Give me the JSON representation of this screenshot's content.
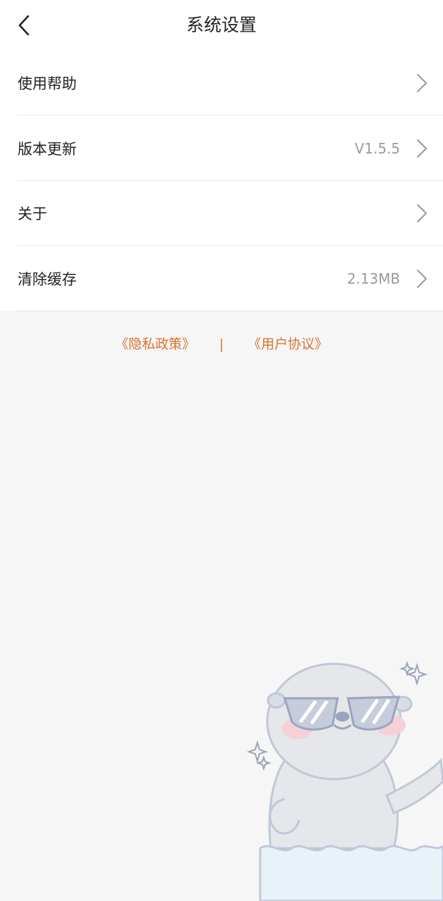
{
  "header": {
    "title": "系统设置"
  },
  "settings": {
    "items": [
      {
        "label": "使用帮助",
        "value": ""
      },
      {
        "label": "版本更新",
        "value": "V1.5.5"
      },
      {
        "label": "关于",
        "value": ""
      },
      {
        "label": "清除缓存",
        "value": "2.13MB"
      }
    ]
  },
  "footer": {
    "privacy": "《隐私政策》",
    "separator": "|",
    "agreement": "《用户协议》"
  },
  "colors": {
    "link": "#d9732e",
    "background": "#f6f6f6",
    "row_value": "#9a9a9a"
  },
  "icons": {
    "back": "chevron-left-icon",
    "row_arrow": "chevron-right-icon",
    "illustration": "otter-sunglasses-illustration"
  }
}
